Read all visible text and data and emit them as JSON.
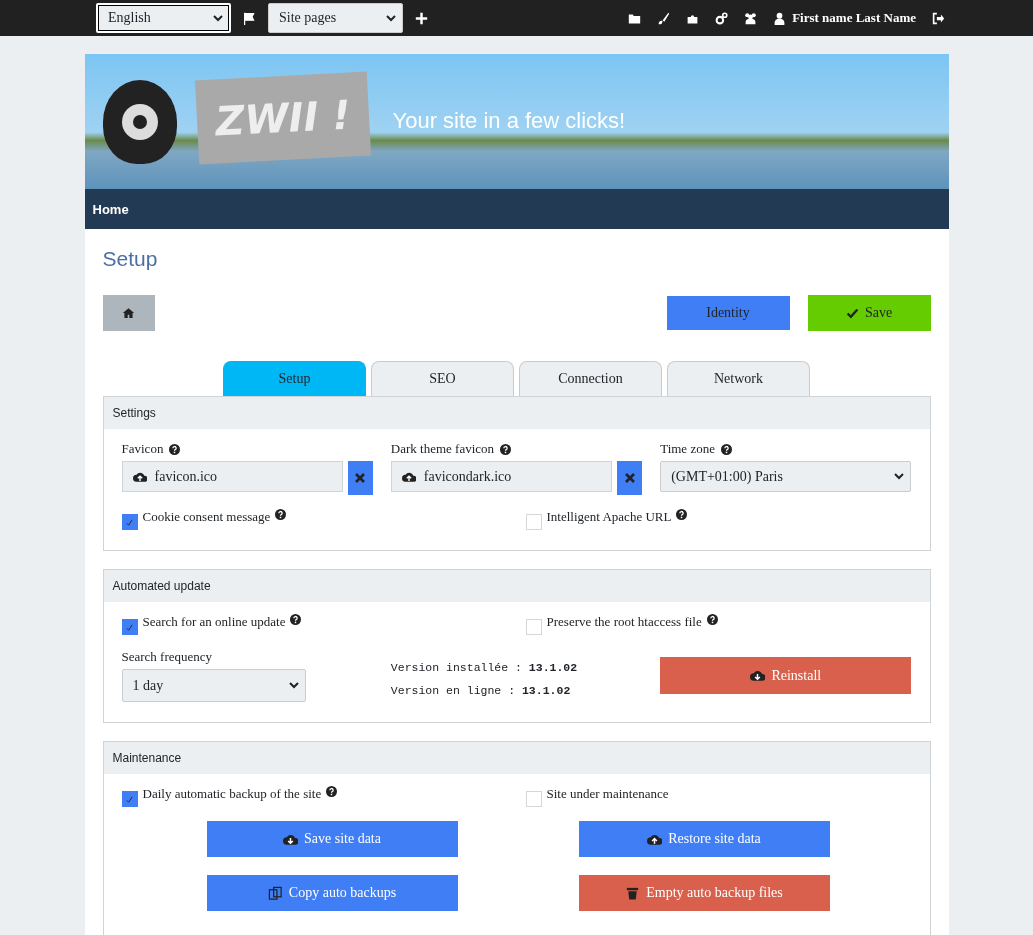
{
  "topbar": {
    "language_select": {
      "value": "English"
    },
    "pages_select": {
      "value": "Site pages"
    },
    "user": "First name Last Name"
  },
  "banner": {
    "logo_text": "ZWII !",
    "title": "Your site in a few clicks!"
  },
  "nav": {
    "items": [
      {
        "label": "Home"
      }
    ]
  },
  "page_title": "Setup",
  "toolbar": {
    "buttons": [
      {
        "label": "Identity",
        "kind": "plain",
        "color": "#3f7ef4"
      },
      {
        "label": "Save",
        "kind": "check",
        "color": "#64cc00"
      }
    ]
  },
  "tabs": [
    {
      "label": "Setup",
      "selected": true
    },
    {
      "label": "SEO",
      "selected": false
    },
    {
      "label": "Connection",
      "selected": false
    },
    {
      "label": "Network",
      "selected": false
    }
  ],
  "sections": [
    {
      "title": "Settings",
      "rows": [
        {
          "items": [
            {
              "kind": "file",
              "label": "Favicon",
              "help": true,
              "value": "favicon.ico"
            },
            {
              "kind": "file",
              "label": "Dark theme favicon",
              "help": true,
              "value": "favicondark.ico"
            },
            {
              "kind": "select",
              "label": "Time zone",
              "help": true,
              "value": "(GMT+01:00) Paris"
            }
          ]
        },
        {
          "items": [
            {
              "kind": "checkbox",
              "label": "Cookie consent message",
              "help": true,
              "checked": true
            },
            {
              "kind": "checkbox",
              "label": "Intelligent Apache URL",
              "help": true,
              "checked": false
            }
          ]
        }
      ]
    },
    {
      "title": "Automated update",
      "rows": [
        {
          "items": [
            {
              "kind": "checkbox",
              "label": "Search for an online update",
              "help": true,
              "checked": true
            },
            {
              "kind": "checkbox",
              "label": "Preserve the root htaccess file",
              "help": true,
              "checked": false
            }
          ]
        },
        {
          "items": [
            {
              "kind": "smallselect",
              "label": "Search frequency",
              "help": false,
              "value": "1 day"
            },
            {
              "kind": "versions",
              "lines": [
                {
                  "label": "Version installée :",
                  "value": "13.1.02"
                },
                {
                  "label": "Version en ligne :",
                  "value": "13.1.02"
                }
              ]
            },
            {
              "kind": "download",
              "label": "Reinstall",
              "color": "#d9604c"
            }
          ]
        }
      ]
    },
    {
      "title": "Maintenance",
      "rows": [
        {
          "items": [
            {
              "kind": "checkbox",
              "label": "Daily automatic backup of the site",
              "help": true,
              "checked": true
            },
            {
              "kind": "checkbox",
              "label": "Site under maintenance",
              "help": false,
              "checked": false
            }
          ]
        },
        {
          "items": [
            {
              "kind": "download",
              "label": "Save site data",
              "color": "#3f7ef4"
            },
            {
              "kind": "upload",
              "label": "Restore site data",
              "color": "#3f7ef4"
            }
          ]
        },
        {
          "items": [
            {
              "kind": "copy",
              "label": "Copy auto backups",
              "color": "#3f7ef4"
            },
            {
              "kind": "trash",
              "label": "Empty auto backup files",
              "color": "#d9604c"
            }
          ]
        }
      ]
    }
  ]
}
